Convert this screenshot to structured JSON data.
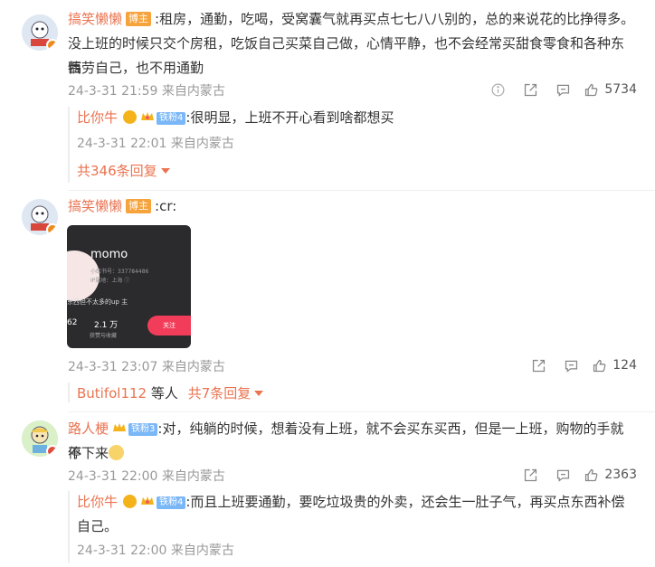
{
  "comments": [
    {
      "username": "搞笑懒懒",
      "host_tag": "博主",
      "text_line1": ":租房，通勤，吃喝，受窝囊气就再买点七七八八别的，总的来说花的比挣得多。",
      "text_line2": "没上班的时候只交个房租，吃饭自己买菜自己做，心情平静，也不会经常买甜食零食和各种东西",
      "text_line3": "犒劳自己，也不用通勤",
      "time": "24-3-31 21:59 来自内蒙古",
      "likes": "5734",
      "reply": {
        "username": "比你牛",
        "fan_tag": "铁粉4",
        "text": ":很明显，上班不开心看到啥都想买",
        "time": "24-3-31 22:01 来自内蒙古"
      },
      "more_replies": "共346条回复"
    },
    {
      "username": "搞笑懒懒",
      "host_tag": "博主",
      "text": ":cr:",
      "image": {
        "name": "momo",
        "line1": "小红书号：337784486",
        "line2": "IP属地：上海 ⓘ",
        "bio": "东西但不太多的up 主",
        "stat1": "62",
        "stat2": "2.1 万",
        "stat2_label": "获赞与收藏",
        "follow": "关注"
      },
      "time": "24-3-31 23:07 来自内蒙古",
      "likes": "124",
      "replies_from": "Butifol112",
      "replies_mid": "等人",
      "more_replies": "共7条回复"
    },
    {
      "username": "路人梗",
      "fan_tag": "铁粉3",
      "text_line1": ":对，纯躺的时候，想着没有上班，就不会买东买西，但是一上班，购物的手就停",
      "text_line2": "不下来",
      "time": "24-3-31 22:00 来自内蒙古",
      "likes": "2363",
      "reply": {
        "username": "比你牛",
        "fan_tag": "铁粉4",
        "text_line1": ":而且上班要通勤，要吃垃圾贵的外卖，还会生一肚子气，再买点东西补偿",
        "text_line2": "自己。",
        "time": "24-3-31 22:00 来自内蒙古"
      }
    }
  ],
  "icons": {
    "info": "info-icon",
    "share": "share-icon",
    "comment": "comment-icon",
    "like": "thumbs-up-icon"
  },
  "colors": {
    "username": "#eb7350",
    "meta": "#999999",
    "host_tag": "#f7a33c",
    "fan_tag": "#7ab7f7"
  }
}
